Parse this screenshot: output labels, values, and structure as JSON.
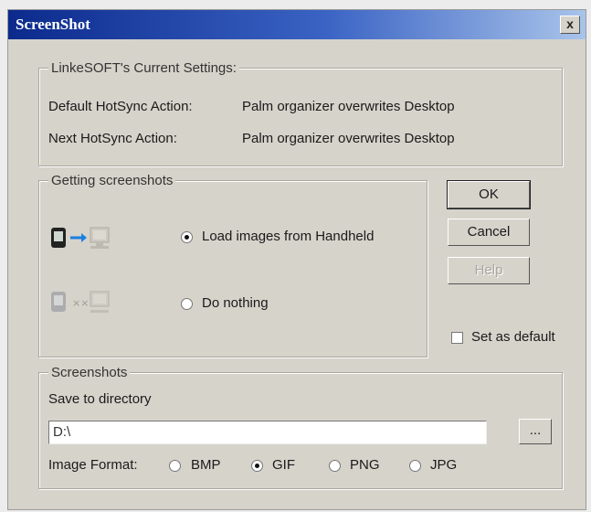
{
  "window": {
    "title": "ScreenShot",
    "close_label": "x"
  },
  "current_settings": {
    "legend": "LinkeSOFT's Current Settings:",
    "rows": [
      {
        "label": "Default HotSync Action:",
        "value": "Palm organizer overwrites Desktop"
      },
      {
        "label": "Next HotSync Action:",
        "value": "Palm organizer overwrites Desktop"
      }
    ]
  },
  "getting": {
    "legend": "Getting screenshots",
    "options": [
      {
        "label": "Load images from Handheld",
        "selected": true
      },
      {
        "label": "Do nothing",
        "selected": false
      }
    ]
  },
  "buttons": {
    "ok": "OK",
    "cancel": "Cancel",
    "help": "Help"
  },
  "set_default": {
    "label": "Set as default",
    "checked": false
  },
  "screenshots": {
    "legend": "Screenshots",
    "save_label": "Save to directory",
    "directory_value": "D:\\",
    "browse_label": "...",
    "format_label": "Image Format:",
    "formats": [
      {
        "label": "BMP",
        "selected": false
      },
      {
        "label": "GIF",
        "selected": true
      },
      {
        "label": "PNG",
        "selected": false
      },
      {
        "label": "JPG",
        "selected": false
      }
    ]
  },
  "colors": {
    "title_start": "#0b2a8c",
    "title_end": "#a9c4ea",
    "face": "#d6d3cb",
    "arrow": "#1a7fe0"
  },
  "icons": {
    "handheld": "handheld-icon",
    "desktop": "desktop-icon",
    "arrow": "arrow-right-icon",
    "no_transfer": "no-transfer-icon"
  }
}
